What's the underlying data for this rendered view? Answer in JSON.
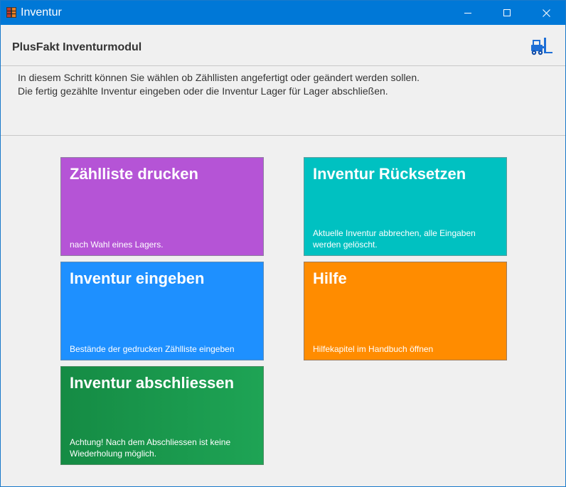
{
  "window": {
    "title": "Inventur"
  },
  "header": {
    "title": "PlusFakt Inventurmodul",
    "icon": "forklift-icon"
  },
  "description": {
    "line1": "In diesem Schritt können Sie wählen ob Zähllisten angefertigt oder geändert werden sollen.",
    "line2": "Die fertig gezählte Inventur eingeben oder die Inventur Lager für Lager abschließen."
  },
  "tiles": [
    {
      "title": "Zählliste drucken",
      "subtitle": "nach Wahl eines Lagers.",
      "color": "#b554d6"
    },
    {
      "title": "Inventur Rücksetzen",
      "subtitle": "Aktuelle Inventur abbrechen, alle Eingaben werden gelöscht.",
      "color": "#00c1c1"
    },
    {
      "title": "Inventur eingeben",
      "subtitle": "Bestände der gedrucken Zählliste eingeben",
      "color": "#1e90ff"
    },
    {
      "title": "Hilfe",
      "subtitle": "Hilfekapitel im Handbuch öffnen",
      "color": "#ff8c00"
    },
    {
      "title": "Inventur abschliessen",
      "subtitle": "Achtung! Nach dem Abschliessen ist keine Wiederholung möglich.",
      "color": "#1a9a4f"
    }
  ],
  "colors": {
    "titlebar": "#0078d7",
    "background": "#f0f0f0"
  }
}
